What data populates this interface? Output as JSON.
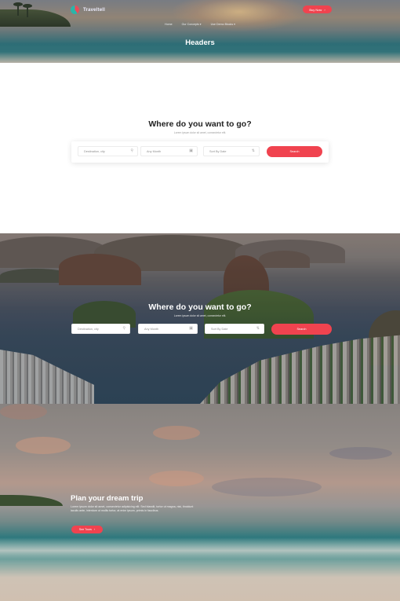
{
  "header": {
    "logo_text": "Traveltell",
    "nav_button": "Buy Now",
    "nav_links": [
      "Home",
      "Our Concepts ▾",
      "Use Demo Blocks ▾"
    ],
    "page_title": "Headers"
  },
  "search_white": {
    "title": "Where do you want to go?",
    "subtitle": "Lorem ipsum dolor sit amet, consectetur elit.",
    "destination_placeholder": "Destination, city",
    "month_placeholder": "Any Month",
    "sort_placeholder": "Sort By Date",
    "search_button": "Search"
  },
  "search_dark": {
    "title": "Where do you want to go?",
    "subtitle": "Lorem ipsum dolor sit amet, consectetur elit.",
    "destination_placeholder": "Destination, city",
    "month_placeholder": "Any Month",
    "sort_placeholder": "Sort By Date",
    "search_button": "Search"
  },
  "dream": {
    "title": "Plan your dream trip",
    "text": "Lorem ipsum dolor sit amet, consectetur adipisicing elit. Sed blandit, tortor ut magna, nisi, tincidunt iaculis ante, interdum ut mollis tortor, at enim ipsum, primis in faucibus.",
    "button": "See Tours"
  },
  "colors": {
    "accent": "#f0434f"
  },
  "icons": {
    "search": "search-icon",
    "calendar": "calendar-icon",
    "sort": "sort-icon",
    "chevron": "chevron-right-icon"
  }
}
